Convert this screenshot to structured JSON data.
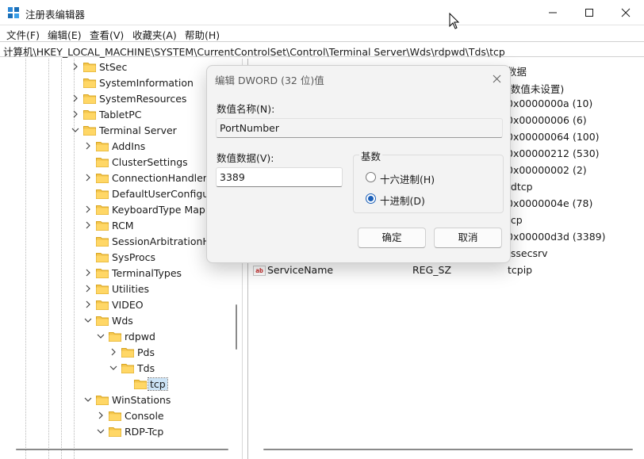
{
  "window": {
    "title": "注册表编辑器",
    "icon": "registry-icon"
  },
  "menu": [
    "文件(F)",
    "编辑(E)",
    "查看(V)",
    "收藏夹(A)",
    "帮助(H)"
  ],
  "address": "计算机\\HKEY_LOCAL_MACHINE\\SYSTEM\\CurrentControlSet\\Control\\Terminal Server\\Wds\\rdpwd\\Tds\\tcp",
  "tree": [
    {
      "label": "StSec",
      "expand": "collapsed"
    },
    {
      "label": "SystemInformation",
      "expand": "none"
    },
    {
      "label": "SystemResources",
      "expand": "collapsed"
    },
    {
      "label": "TabletPC",
      "expand": "collapsed"
    },
    {
      "label": "Terminal Server",
      "expand": "expanded"
    },
    {
      "label": "AddIns",
      "expand": "collapsed"
    },
    {
      "label": "ClusterSettings",
      "expand": "none"
    },
    {
      "label": "ConnectionHandler",
      "expand": "collapsed"
    },
    {
      "label": "DefaultUserConfigura",
      "expand": "none"
    },
    {
      "label": "KeyboardType Mapp",
      "expand": "collapsed"
    },
    {
      "label": "RCM",
      "expand": "collapsed"
    },
    {
      "label": "SessionArbitrationHe",
      "expand": "none"
    },
    {
      "label": "SysProcs",
      "expand": "none"
    },
    {
      "label": "TerminalTypes",
      "expand": "collapsed"
    },
    {
      "label": "Utilities",
      "expand": "collapsed"
    },
    {
      "label": "VIDEO",
      "expand": "collapsed"
    },
    {
      "label": "Wds",
      "expand": "expanded"
    },
    {
      "label": "rdpwd",
      "expand": "expanded"
    },
    {
      "label": "Pds",
      "expand": "collapsed"
    },
    {
      "label": "Tds",
      "expand": "expanded"
    },
    {
      "label": "tcp",
      "expand": "none",
      "selected": true
    },
    {
      "label": "WinStations",
      "expand": "expanded"
    },
    {
      "label": "Console",
      "expand": "collapsed"
    },
    {
      "label": "RDP-Tcp",
      "expand": "expanded"
    }
  ],
  "values_header": {
    "data": "数据"
  },
  "values": [
    {
      "name": "",
      "type": "",
      "data": "(数值未设置)"
    },
    {
      "name": "",
      "type": "",
      "data": "0x0000000a (10)"
    },
    {
      "name": "",
      "type": "",
      "data": "0x00000006 (6)"
    },
    {
      "name": "",
      "type": "",
      "data": "0x00000064 (100)"
    },
    {
      "name": "",
      "type": "",
      "data": "0x00000212 (530)"
    },
    {
      "name": "",
      "type": "",
      "data": "0x00000002 (2)"
    },
    {
      "name": "",
      "type": "",
      "data": "rdtcp"
    },
    {
      "name": "",
      "type": "",
      "data": "0x0000004e (78)"
    },
    {
      "name": "",
      "type": "",
      "data": "tcp"
    },
    {
      "name": "",
      "type": "",
      "data": "0x00000d3d (3389)"
    },
    {
      "name": "",
      "type": "",
      "data": "tssecsrv"
    },
    {
      "name": "ServiceName",
      "type": "REG_SZ",
      "data": "tcpip"
    }
  ],
  "dialog": {
    "title": "编辑 DWORD (32 位)值",
    "name_label": "数值名称(N):",
    "name_value": "PortNumber",
    "data_label": "数值数据(V):",
    "data_value": "3389",
    "base_label": "基数",
    "radio_hex": "十六进制(H)",
    "radio_dec": "十进制(D)",
    "selected_base": "decimal",
    "ok": "确定",
    "cancel": "取消"
  }
}
